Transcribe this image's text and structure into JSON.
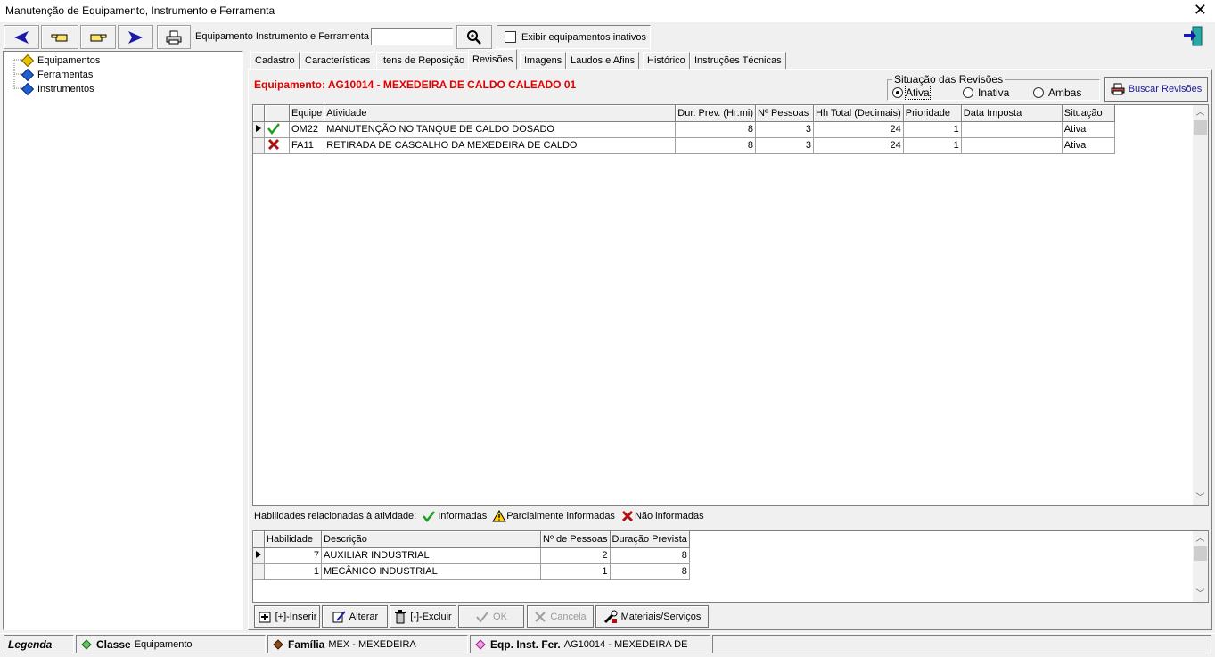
{
  "window": {
    "title": "Manutenção de Equipamento, Instrumento e Ferramenta",
    "close": "✕"
  },
  "toolbar": {
    "search_label": "Equipamento Instrumento e Ferramenta",
    "search_value": "",
    "inactive_checkbox_label": "Exibir equipamentos inativos",
    "inactive_checked": false
  },
  "tree": {
    "items": [
      {
        "label": "Equipamentos",
        "selected": true
      },
      {
        "label": "Ferramentas",
        "selected": false
      },
      {
        "label": "Instrumentos",
        "selected": false
      }
    ]
  },
  "tabs": [
    {
      "label": "Cadastro"
    },
    {
      "label": "Características"
    },
    {
      "label": "Itens de Reposição"
    },
    {
      "label": "Revisões",
      "active": true
    },
    {
      "label": "Imagens"
    },
    {
      "label": "Laudos e Afins"
    },
    {
      "label": "Histórico"
    },
    {
      "label": "Instruções Técnicas"
    }
  ],
  "revisoes": {
    "equipment_title": "Equipamento: AG10014 - MEXEDEIRA DE CALDO CALEADO 01",
    "filter": {
      "legend": "Situação das Revisões",
      "options": [
        "Ativa",
        "Inativa",
        "Ambas"
      ],
      "selected": "Ativa"
    },
    "search_button": "Buscar Revisões",
    "columns": [
      "Equipe",
      "Atividade",
      "Dur. Prev. (Hr:mi)",
      "Nº Pessoas",
      "Hh Total (Decimais)",
      "Prioridade",
      "Data Imposta",
      "Situação"
    ],
    "rows": [
      {
        "status_icon": "check-icon",
        "equipe": "OM22",
        "atividade": "MANUTENÇÃO NO TANQUE DE CALDO DOSADO",
        "dur": "8",
        "pessoas": "3",
        "hh": "24",
        "prioridade": "1",
        "data": "",
        "situacao": "Ativa",
        "current": true
      },
      {
        "status_icon": "x-icon",
        "equipe": "FA11",
        "atividade": "RETIRADA DE CASCALHO DA MEXEDEIRA DE CALDO",
        "dur": "8",
        "pessoas": "3",
        "hh": "24",
        "prioridade": "1",
        "data": "",
        "situacao": "Ativa",
        "current": false
      }
    ]
  },
  "legend_strip": {
    "label": "Habilidades relacionadas à atividade:",
    "informadas": "Informadas",
    "parcial": "Parcialmente informadas",
    "nao": "Não informadas"
  },
  "habilidades": {
    "columns": [
      "Habilidade",
      "Descrição",
      "Nº de Pessoas",
      "Duração Prevista"
    ],
    "rows": [
      {
        "habilidade": "7",
        "descricao": "AUXILIAR INDUSTRIAL",
        "pessoas": "2",
        "duracao": "8",
        "current": true
      },
      {
        "habilidade": "1",
        "descricao": "MECÂNICO INDUSTRIAL",
        "pessoas": "1",
        "duracao": "8",
        "current": false
      }
    ]
  },
  "actions": {
    "inserir": "[+]-Inserir",
    "alterar": "Alterar",
    "excluir": "[-]-Excluir",
    "ok": "OK",
    "cancela": "Cancela",
    "materiais": "Materiais/Serviços"
  },
  "status": {
    "legenda": "Legenda",
    "classe_label": "Classe",
    "classe_value": "Equipamento",
    "familia_label": "Família",
    "familia_value": "MEX - MEXEDEIRA",
    "eqp_label": "Eqp. Inst. Fer.",
    "eqp_value": "AG10014 - MEXEDEIRA DE"
  },
  "colors": {
    "title_red": "#e00000",
    "accent_blue": "#1a1aa6",
    "check_green": "#1e9e1e",
    "x_red": "#b01010"
  }
}
